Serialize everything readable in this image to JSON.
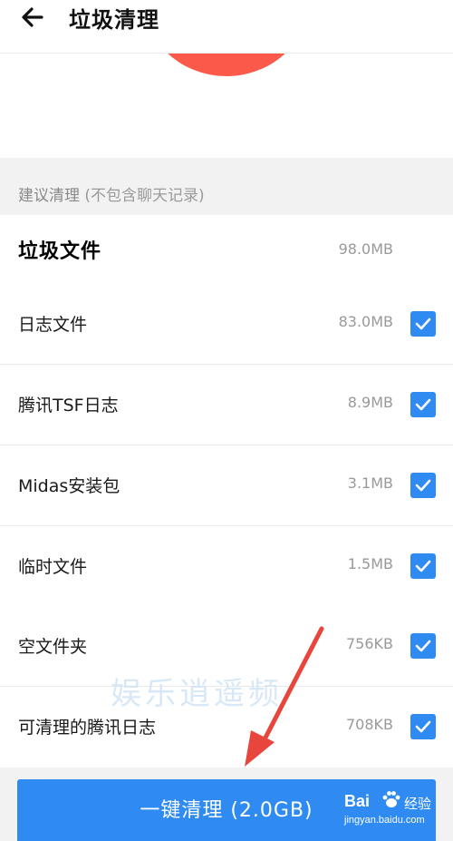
{
  "header": {
    "title": "垃圾清理"
  },
  "section": {
    "title": "建议清理",
    "note": "(不包含聊天记录)"
  },
  "group": {
    "label": "垃圾文件",
    "size": "98.0MB"
  },
  "items": [
    {
      "label": "日志文件",
      "size": "83.0MB",
      "checked": true
    },
    {
      "label": "腾讯TSF日志",
      "size": "8.9MB",
      "checked": true
    },
    {
      "label": "Midas安装包",
      "size": "3.1MB",
      "checked": true
    },
    {
      "label": "临时文件",
      "size": "1.5MB",
      "checked": true
    },
    {
      "label": "空文件夹",
      "size": "756KB",
      "checked": true
    },
    {
      "label": "可清理的腾讯日志",
      "size": "708KB",
      "checked": true
    }
  ],
  "action": {
    "clean_label": "一键清理 (2.0GB)"
  },
  "watermark": {
    "text": "娱乐逍遥频"
  },
  "baidu": {
    "logo": "Bai",
    "logo2": "经验",
    "url": "jingyan.baidu.com"
  },
  "colors": {
    "accent": "#2f8bf2",
    "hero": "#fb5a4a",
    "annotation_arrow": "#e8453c"
  },
  "icons": {
    "back": "arrow-left-icon",
    "check": "checkmark-icon",
    "paw": "baidu-paw-icon"
  }
}
